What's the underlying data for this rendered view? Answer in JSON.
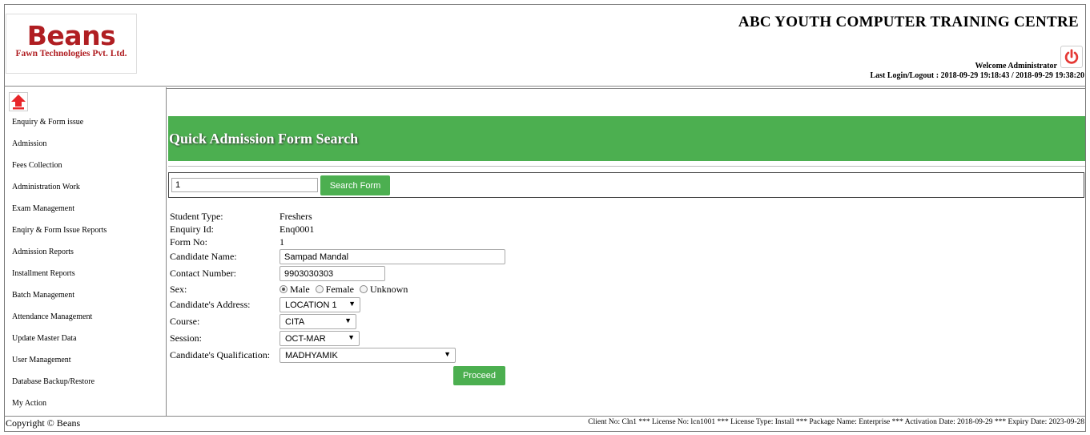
{
  "header": {
    "logo_title": "Beans",
    "logo_subtitle": "Fawn Technologies Pvt. Ltd.",
    "org_title": "ABC YOUTH COMPUTER TRAINING CENTRE",
    "welcome": "Welcome Administrator",
    "last_login": "Last Login/Logout : 2018-09-29 19:18:43 / 2018-09-29 19:38:20"
  },
  "sidebar": {
    "items": [
      {
        "label": "Enquiry & Form issue"
      },
      {
        "label": "Admission"
      },
      {
        "label": "Fees Collection"
      },
      {
        "label": "Administration Work"
      },
      {
        "label": "Exam Management"
      },
      {
        "label": "Enqiry & Form Issue Reports"
      },
      {
        "label": "Admission Reports"
      },
      {
        "label": "Installment Reports"
      },
      {
        "label": "Batch Management"
      },
      {
        "label": "Attendance Management"
      },
      {
        "label": "Update Master Data"
      },
      {
        "label": "User Management"
      },
      {
        "label": "Database Backup/Restore"
      },
      {
        "label": "My Action"
      }
    ]
  },
  "main": {
    "title": "Quick Admission Form Search",
    "search_value": "1",
    "search_button": "Search Form",
    "fields": {
      "student_type_label": "Student Type:",
      "student_type_value": "Freshers",
      "enquiry_id_label": "Enquiry Id:",
      "enquiry_id_value": "Enq0001",
      "form_no_label": "Form No:",
      "form_no_value": "1",
      "candidate_name_label": "Candidate Name:",
      "candidate_name_value": "Sampad Mandal",
      "contact_label": "Contact Number:",
      "contact_value": "9903030303",
      "sex_label": "Sex:",
      "sex_options": [
        "Male",
        "Female",
        "Unknown"
      ],
      "sex_selected": "Male",
      "address_label": "Candidate's Address:",
      "address_value": "LOCATION 1",
      "course_label": "Course:",
      "course_value": "CITA",
      "session_label": "Session:",
      "session_value": "OCT-MAR",
      "qualification_label": "Candidate's Qualification:",
      "qualification_value": "MADHYAMIK"
    },
    "proceed_button": "Proceed"
  },
  "footer": {
    "copyright": "Copyright © Beans",
    "license": "Client No: Cln1 *** License No: lcn1001 *** License Type: Install *** Package Name: Enterprise *** Activation Date: 2018-09-29 *** Expiry Date: 2023-09-28"
  },
  "colors": {
    "brand_red": "#b01e22",
    "accent_green": "#4caf50",
    "power_red": "#e53935"
  }
}
